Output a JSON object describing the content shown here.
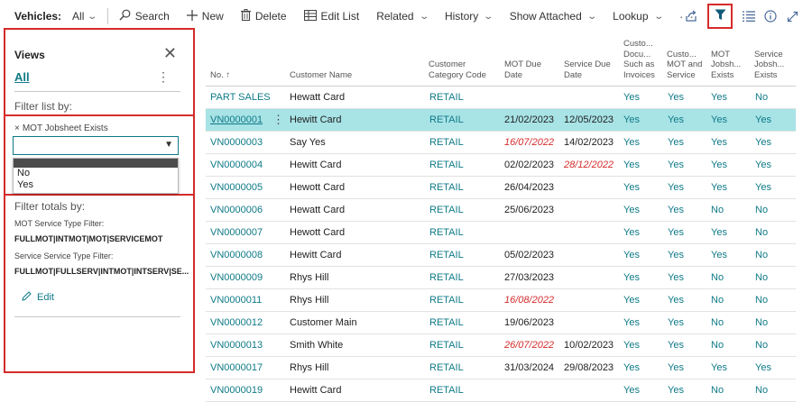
{
  "toolbar": {
    "page_title": "Vehicles:",
    "view_label": "All",
    "actions": {
      "search": "Search",
      "new": "New",
      "delete": "Delete",
      "edit_list": "Edit List",
      "related": "Related",
      "history": "History",
      "show_attached": "Show Attached",
      "lookup": "Lookup",
      "more": "···"
    },
    "right_icons": [
      "share-icon",
      "filter-icon",
      "list-view-icon",
      "info-icon",
      "expand-icon"
    ]
  },
  "filter_pane": {
    "views_title": "Views",
    "view_all": "All",
    "filter_list_by": "Filter list by:",
    "active_filter": {
      "remove_glyph": "×",
      "field": "MOT Jobsheet Exists",
      "value": "",
      "options": [
        "",
        "No",
        "Yes"
      ]
    },
    "filter_totals_by": "Filter totals by:",
    "totals": [
      {
        "label": "MOT Service Type Filter:",
        "value": "FULLMOT|INTMOT|MOT|SERVICEMOT"
      },
      {
        "label": "Service Service Type Filter:",
        "value": "FULLMOT|FULLSERV|INTMOT|INTSERV|SE..."
      }
    ],
    "edit_label": "Edit"
  },
  "table": {
    "columns": [
      "No. ↑",
      "Customer Name",
      "Customer Category Code",
      "MOT Due Date",
      "Service Due Date",
      "Custo... Docu... Such as Invoices",
      "Custo... MOT and Service",
      "MOT Jobsh... Exists",
      "Service Jobsh... Exists"
    ],
    "rows": [
      {
        "no": "PART SALES",
        "name": "Hewatt Card",
        "cat": "RETAIL",
        "mot": "",
        "service": "",
        "docs": "Yes",
        "motsvc": "Yes",
        "motjob": "Yes",
        "svcjob": "No"
      },
      {
        "no": "VN0000001",
        "name": "Hewitt Card",
        "cat": "RETAIL",
        "mot": "21/02/2023",
        "service": "12/05/2023",
        "docs": "Yes",
        "motsvc": "Yes",
        "motjob": "Yes",
        "svcjob": "Yes"
      },
      {
        "no": "VN0000003",
        "name": "Say Yes",
        "cat": "RETAIL",
        "mot": "16/07/2022",
        "service": "14/02/2023",
        "docs": "Yes",
        "motsvc": "Yes",
        "motjob": "Yes",
        "svcjob": "Yes"
      },
      {
        "no": "VN0000004",
        "name": "Hewitt Card",
        "cat": "RETAIL",
        "mot": "02/02/2023",
        "service": "28/12/2022",
        "docs": "Yes",
        "motsvc": "Yes",
        "motjob": "Yes",
        "svcjob": "Yes"
      },
      {
        "no": "VN0000005",
        "name": "Hewott Card",
        "cat": "RETAIL",
        "mot": "26/04/2023",
        "service": "",
        "docs": "Yes",
        "motsvc": "Yes",
        "motjob": "Yes",
        "svcjob": "Yes"
      },
      {
        "no": "VN0000006",
        "name": "Hewatt Card",
        "cat": "RETAIL",
        "mot": "25/06/2023",
        "service": "",
        "docs": "Yes",
        "motsvc": "Yes",
        "motjob": "No",
        "svcjob": "No"
      },
      {
        "no": "VN0000007",
        "name": "Hewott Card",
        "cat": "RETAIL",
        "mot": "",
        "service": "",
        "docs": "Yes",
        "motsvc": "Yes",
        "motjob": "Yes",
        "svcjob": "No"
      },
      {
        "no": "VN0000008",
        "name": "Hewitt Card",
        "cat": "RETAIL",
        "mot": "05/02/2023",
        "service": "",
        "docs": "Yes",
        "motsvc": "Yes",
        "motjob": "Yes",
        "svcjob": "No"
      },
      {
        "no": "VN0000009",
        "name": "Rhys Hill",
        "cat": "RETAIL",
        "mot": "27/03/2023",
        "service": "",
        "docs": "Yes",
        "motsvc": "Yes",
        "motjob": "No",
        "svcjob": "No"
      },
      {
        "no": "VN0000011",
        "name": "Rhys Hill",
        "cat": "RETAIL",
        "mot": "16/08/2022",
        "service": "",
        "docs": "Yes",
        "motsvc": "Yes",
        "motjob": "No",
        "svcjob": "No"
      },
      {
        "no": "VN0000012",
        "name": "Customer Main",
        "cat": "RETAIL",
        "mot": "19/06/2023",
        "service": "",
        "docs": "Yes",
        "motsvc": "Yes",
        "motjob": "No",
        "svcjob": "No"
      },
      {
        "no": "VN0000013",
        "name": "Smith White",
        "cat": "RETAIL",
        "mot": "26/07/2022",
        "service": "10/02/2023",
        "docs": "Yes",
        "motsvc": "Yes",
        "motjob": "No",
        "svcjob": "No"
      },
      {
        "no": "VN0000017",
        "name": "Rhys Hill",
        "cat": "RETAIL",
        "mot": "31/03/2024",
        "service": "29/08/2023",
        "docs": "Yes",
        "motsvc": "Yes",
        "motjob": "Yes",
        "svcjob": "Yes"
      },
      {
        "no": "VN0000019",
        "name": "Hewitt Card",
        "cat": "RETAIL",
        "mot": "",
        "service": "",
        "docs": "Yes",
        "motsvc": "Yes",
        "motjob": "No",
        "svcjob": "No"
      }
    ]
  },
  "colors": {
    "accent": "#0e7a87",
    "highlight_border": "#d52b2b",
    "selected_row": "#a8e3e6",
    "overdue": "#d52b2b"
  }
}
